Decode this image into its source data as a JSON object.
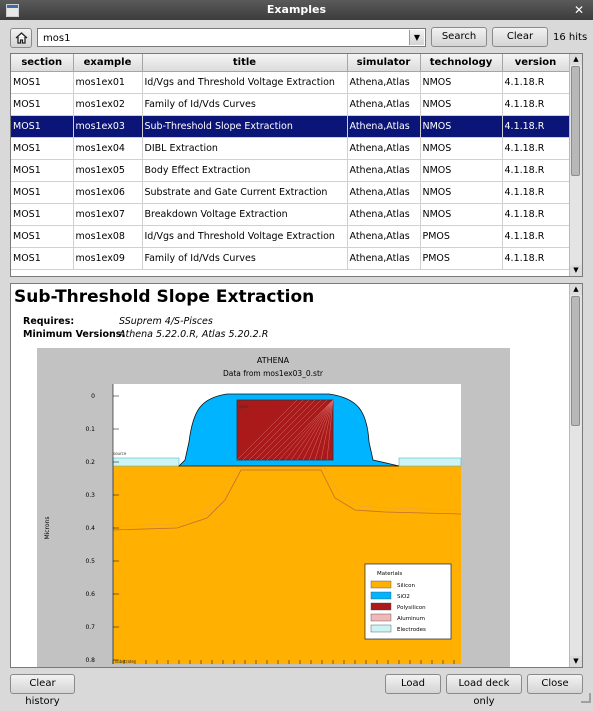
{
  "window": {
    "title": "Examples"
  },
  "toolbar": {
    "search_value": "mos1",
    "search_button": "Search",
    "clear_button": "Clear",
    "hits": "16 hits"
  },
  "table": {
    "columns": [
      "section",
      "example",
      "title",
      "simulator",
      "technology",
      "version"
    ],
    "selected_index": 2,
    "rows": [
      [
        "MOS1",
        "mos1ex01",
        "Id/Vgs and Threshold Voltage Extraction",
        "Athena,Atlas",
        "NMOS",
        "4.1.18.R"
      ],
      [
        "MOS1",
        "mos1ex02",
        "Family of Id/Vds Curves",
        "Athena,Atlas",
        "NMOS",
        "4.1.18.R"
      ],
      [
        "MOS1",
        "mos1ex03",
        "Sub-Threshold Slope Extraction",
        "Athena,Atlas",
        "NMOS",
        "4.1.18.R"
      ],
      [
        "MOS1",
        "mos1ex04",
        "DIBL Extraction",
        "Athena,Atlas",
        "NMOS",
        "4.1.18.R"
      ],
      [
        "MOS1",
        "mos1ex05",
        "Body Effect Extraction",
        "Athena,Atlas",
        "NMOS",
        "4.1.18.R"
      ],
      [
        "MOS1",
        "mos1ex06",
        "Substrate and Gate Current Extraction",
        "Athena,Atlas",
        "NMOS",
        "4.1.18.R"
      ],
      [
        "MOS1",
        "mos1ex07",
        "Breakdown Voltage Extraction",
        "Athena,Atlas",
        "NMOS",
        "4.1.18.R"
      ],
      [
        "MOS1",
        "mos1ex08",
        "Id/Vgs and Threshold Voltage Extraction",
        "Athena,Atlas",
        "PMOS",
        "4.1.18.R"
      ],
      [
        "MOS1",
        "mos1ex09",
        "Family of Id/Vds Curves",
        "Athena,Atlas",
        "PMOS",
        "4.1.18.R"
      ]
    ]
  },
  "doc": {
    "heading": "Sub-Threshold Slope Extraction",
    "requires_label": "Requires:",
    "requires_value": "SSuprem 4/S-Pisces",
    "minver_label": "Minimum Versions:",
    "minver_value": "Athena 5.22.0.R, Atlas 5.20.2.R"
  },
  "plot": {
    "title": "ATHENA",
    "subtitle": "Data from mos1ex03_0.str",
    "ylabel": "Microns",
    "y_ticks": [
      "0",
      "0.1",
      "0.2",
      "0.3",
      "0.4",
      "0.5",
      "0.6",
      "0.7",
      "0.8"
    ],
    "legend_title": "Materials",
    "legend": [
      {
        "name": "Silicon",
        "color": "#ffb000"
      },
      {
        "name": "SiO2",
        "color": "#00b4ff"
      },
      {
        "name": "Polysilicon",
        "color": "#aa1a1a"
      },
      {
        "name": "Aluminum",
        "color": "#f0b8b8"
      },
      {
        "name": "Electrodes",
        "color": "#ccf4f4"
      }
    ],
    "electrode_labels": [
      "gate",
      "source",
      "drain",
      "substrate"
    ]
  },
  "buttons": {
    "clear_history": "Clear history",
    "load": "Load",
    "load_deck_only": "Load deck only",
    "close": "Close"
  }
}
